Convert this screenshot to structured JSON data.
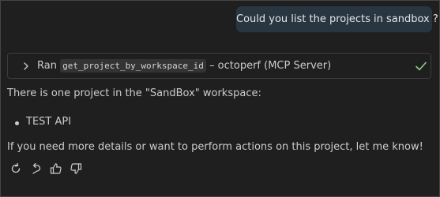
{
  "user_message": "Could you list the projects in sandbox ?",
  "tool_call": {
    "prefix": "Ran",
    "tool_name": "get_project_by_workspace_id",
    "suffix": "– octoperf (MCP Server)",
    "expand_icon": "chevron-right-icon",
    "status_icon": "checkmark-icon",
    "status_color": "#89d185"
  },
  "response": {
    "intro": "There is one project in the \"SandBox\" workspace:",
    "items": [
      "TEST API"
    ],
    "outro": "If you need more details or want to perform actions on this project, let me know!"
  },
  "actions": [
    {
      "icon": "retry-icon"
    },
    {
      "icon": "undo-icon"
    },
    {
      "icon": "thumbs-up-icon"
    },
    {
      "icon": "thumbs-down-icon"
    }
  ]
}
